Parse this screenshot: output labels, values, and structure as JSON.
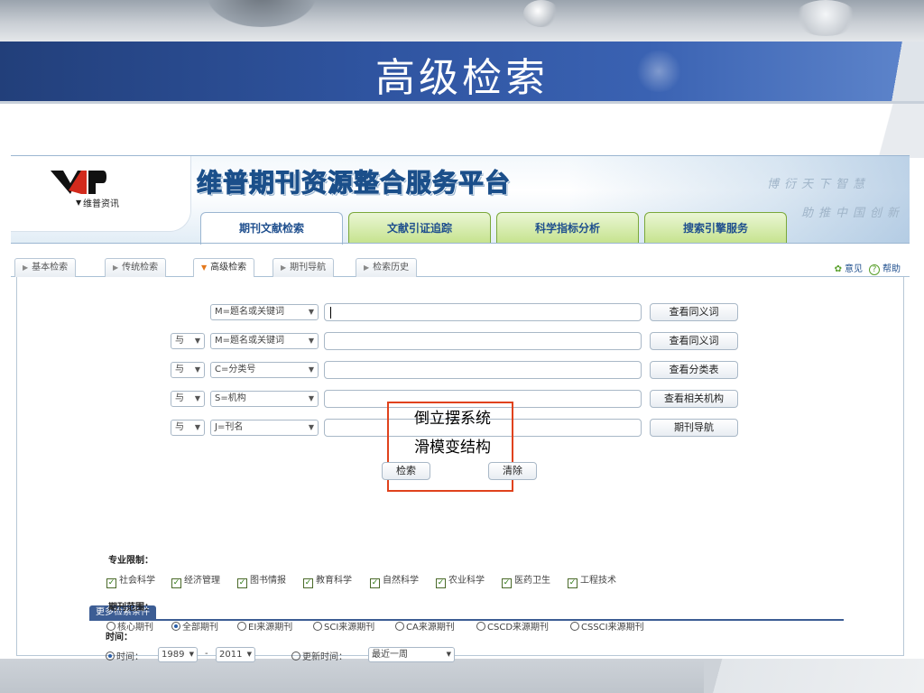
{
  "slide": {
    "title": "高级检索"
  },
  "header": {
    "logo_text": "维普资讯",
    "brand_title": "维普期刊资源整合服务平台",
    "slogan_line1": "博衍天下智慧",
    "slogan_line2": "助推中国创新",
    "main_tabs": [
      {
        "label": "期刊文献检索",
        "active": true
      },
      {
        "label": "文献引证追踪",
        "active": false
      },
      {
        "label": "科学指标分析",
        "active": false
      },
      {
        "label": "搜索引擎服务",
        "active": false
      }
    ]
  },
  "subtabs": [
    {
      "label": "基本检索",
      "active": false
    },
    {
      "label": "传统检索",
      "active": false
    },
    {
      "label": "高级检索",
      "active": true
    },
    {
      "label": "期刊导航",
      "active": false
    },
    {
      "label": "检索历史",
      "active": false
    }
  ],
  "topright": {
    "feedback": "意见",
    "help": "帮助"
  },
  "search_rows": [
    {
      "logic": "",
      "field": "M=题名或关键词",
      "value": "",
      "button": "查看同义词"
    },
    {
      "logic": "与",
      "field": "M=题名或关键词",
      "value": "",
      "button": "查看同义词"
    },
    {
      "logic": "与",
      "field": "C=分类号",
      "value": "",
      "button": "查看分类表"
    },
    {
      "logic": "与",
      "field": "S=机构",
      "value": "",
      "button": "查看相关机构"
    },
    {
      "logic": "与",
      "field": "J=刊名",
      "value": "",
      "button": "期刊导航"
    }
  ],
  "annotation": {
    "line1": "倒立摆系统",
    "line2": "滑模变结构"
  },
  "actions": {
    "search": "检索",
    "clear": "清除"
  },
  "more": {
    "tab_label": "更多检索条件",
    "time_label": "时间：",
    "time_option": "时间：",
    "time_from": "1989",
    "time_sep": "-",
    "time_to": "2011",
    "update_option": "更新时间：",
    "update_value": "最近一周",
    "subject_label": "专业限制：",
    "subjects": [
      "社会科学",
      "经济管理",
      "图书情报",
      "教育科学",
      "自然科学",
      "农业科学",
      "医药卫生",
      "工程技术"
    ],
    "range_label": "期刊范围：",
    "ranges": [
      {
        "label": "核心期刊",
        "selected": false
      },
      {
        "label": "全部期刊",
        "selected": true
      },
      {
        "label": "EI来源期刊",
        "selected": false
      },
      {
        "label": "SCI来源期刊",
        "selected": false
      },
      {
        "label": "CA来源期刊",
        "selected": false
      },
      {
        "label": "CSCD来源期刊",
        "selected": false
      },
      {
        "label": "CSSCI来源期刊",
        "selected": false
      }
    ]
  },
  "colors": {
    "band": "#2f54a0",
    "tab_green": "#c6e38f",
    "highlight": "#e0421c",
    "link": "#1f4f8e"
  }
}
